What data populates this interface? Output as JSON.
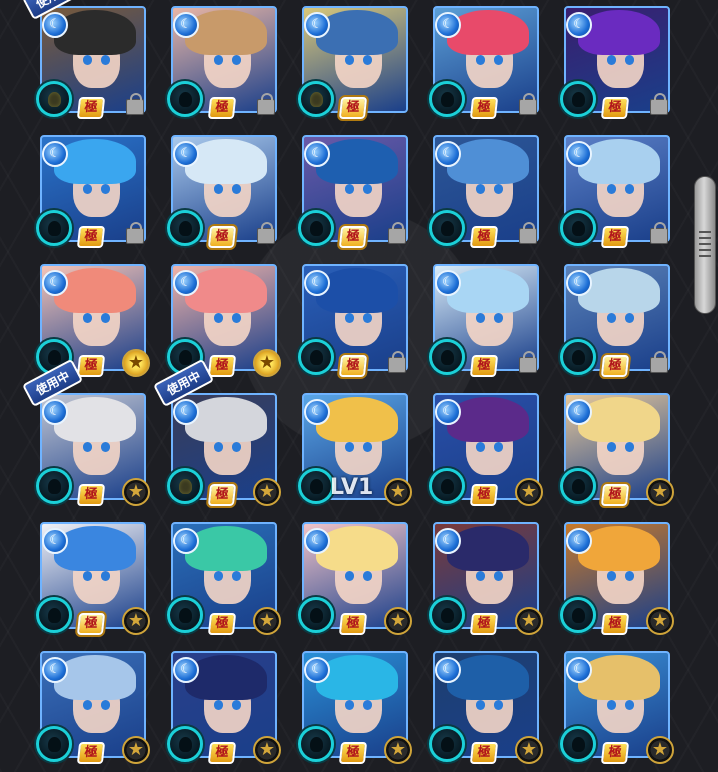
{
  "labels": {
    "kiwami": "極",
    "in_use": "使用中",
    "star": "★",
    "element": "☾"
  },
  "cards": [
    {
      "hair": "#2b2b2b",
      "bg": "#7a5b3a",
      "kiwami": "normal",
      "corner": "lock",
      "slot": "filled",
      "in_use": true
    },
    {
      "hair": "#c89a6a",
      "bg": "#e9b6a6",
      "kiwami": "normal",
      "corner": "lock",
      "slot": "empty",
      "in_use": false
    },
    {
      "hair": "#3b6fb3",
      "bg": "#d9c87a",
      "kiwami": "boxed",
      "corner": "none",
      "slot": "filled",
      "in_use": false
    },
    {
      "hair": "#e84a6a",
      "bg": "#5c9fd6",
      "kiwami": "normal",
      "corner": "lock",
      "slot": "empty",
      "in_use": false
    },
    {
      "hair": "#6a2bc0",
      "bg": "#3a1e6e",
      "kiwami": "normal",
      "corner": "lock",
      "slot": "empty",
      "in_use": false
    },
    {
      "hair": "#3aa6ef",
      "bg": "#2a73c9",
      "kiwami": "normal",
      "corner": "lock",
      "slot": "empty",
      "in_use": false
    },
    {
      "hair": "#d6e8f6",
      "bg": "#a9c9ec",
      "kiwami": "boxed",
      "corner": "lock",
      "slot": "empty",
      "in_use": false
    },
    {
      "hair": "#1e5fb0",
      "bg": "#6b5aa8",
      "kiwami": "boxed",
      "corner": "lock",
      "slot": "empty",
      "in_use": false
    },
    {
      "hair": "#4f8fd6",
      "bg": "#2d5796",
      "kiwami": "normal",
      "corner": "lock",
      "slot": "empty",
      "in_use": false
    },
    {
      "hair": "#a9d0ef",
      "bg": "#5b7fc6",
      "kiwami": "normal",
      "corner": "lock",
      "slot": "empty",
      "in_use": false
    },
    {
      "hair": "#f08a7a",
      "bg": "#f6c4b6",
      "kiwami": "normal",
      "corner": "star-gold",
      "slot": "empty",
      "in_use": false
    },
    {
      "hair": "#f08a8a",
      "bg": "#f0b3a8",
      "kiwami": "normal",
      "corner": "star-gold",
      "slot": "empty",
      "in_use": false
    },
    {
      "hair": "#1c4fa8",
      "bg": "#2a5fb8",
      "kiwami": "boxed",
      "corner": "lock",
      "slot": "empty",
      "in_use": false
    },
    {
      "hair": "#a9d6f4",
      "bg": "#d9ecf8",
      "kiwami": "normal",
      "corner": "lock",
      "slot": "empty",
      "in_use": false
    },
    {
      "hair": "#b8d6ea",
      "bg": "#5b82b8",
      "kiwami": "boxed",
      "corner": "lock",
      "slot": "empty",
      "in_use": false
    },
    {
      "hair": "#e2e2e6",
      "bg": "#c2c6d2",
      "kiwami": "normal",
      "corner": "star",
      "slot": "empty",
      "in_use": true
    },
    {
      "hair": "#d4d6dc",
      "bg": "#3a3d58",
      "kiwami": "boxed",
      "corner": "star",
      "slot": "filled",
      "in_use": true
    },
    {
      "hair": "#f0c04a",
      "bg": "#5aa6e6",
      "kiwami": "none",
      "corner": "star",
      "slot": "empty",
      "in_use": false,
      "level": "LV1"
    },
    {
      "hair": "#5b2a8a",
      "bg": "#2a4fa8",
      "kiwami": "normal",
      "corner": "star",
      "slot": "empty",
      "in_use": false
    },
    {
      "hair": "#f0d68a",
      "bg": "#e6c89a",
      "kiwami": "boxed",
      "corner": "star",
      "slot": "empty",
      "in_use": false
    },
    {
      "hair": "#3a86e0",
      "bg": "#f2f2f6",
      "kiwami": "boxed",
      "corner": "star",
      "slot": "empty",
      "in_use": false
    },
    {
      "hair": "#3ac8a6",
      "bg": "#2a6fb8",
      "kiwami": "normal",
      "corner": "star",
      "slot": "empty",
      "in_use": false
    },
    {
      "hair": "#f6dc8a",
      "bg": "#f2c4c8",
      "kiwami": "normal",
      "corner": "star",
      "slot": "empty",
      "in_use": false
    },
    {
      "hair": "#2a2a6a",
      "bg": "#7a3a3a",
      "kiwami": "normal",
      "corner": "star",
      "slot": "empty",
      "in_use": false
    },
    {
      "hair": "#f0a63a",
      "bg": "#c87a2a",
      "kiwami": "normal",
      "corner": "star",
      "slot": "empty",
      "in_use": false
    },
    {
      "hair": "#a6c6ea",
      "bg": "#3a6fb8",
      "kiwami": "normal",
      "corner": "star",
      "slot": "empty",
      "in_use": false
    },
    {
      "hair": "#1e2a6a",
      "bg": "#2a3f8a",
      "kiwami": "normal",
      "corner": "star",
      "slot": "empty",
      "in_use": false
    },
    {
      "hair": "#2ab6e6",
      "bg": "#2a8fd6",
      "kiwami": "normal",
      "corner": "star",
      "slot": "empty",
      "in_use": false
    },
    {
      "hair": "#1e5fa8",
      "bg": "#1e3f6e",
      "kiwami": "normal",
      "corner": "star",
      "slot": "empty",
      "in_use": false
    },
    {
      "hair": "#e6c06a",
      "bg": "#3a8fd6",
      "kiwami": "normal",
      "corner": "star",
      "slot": "empty",
      "in_use": false
    }
  ]
}
